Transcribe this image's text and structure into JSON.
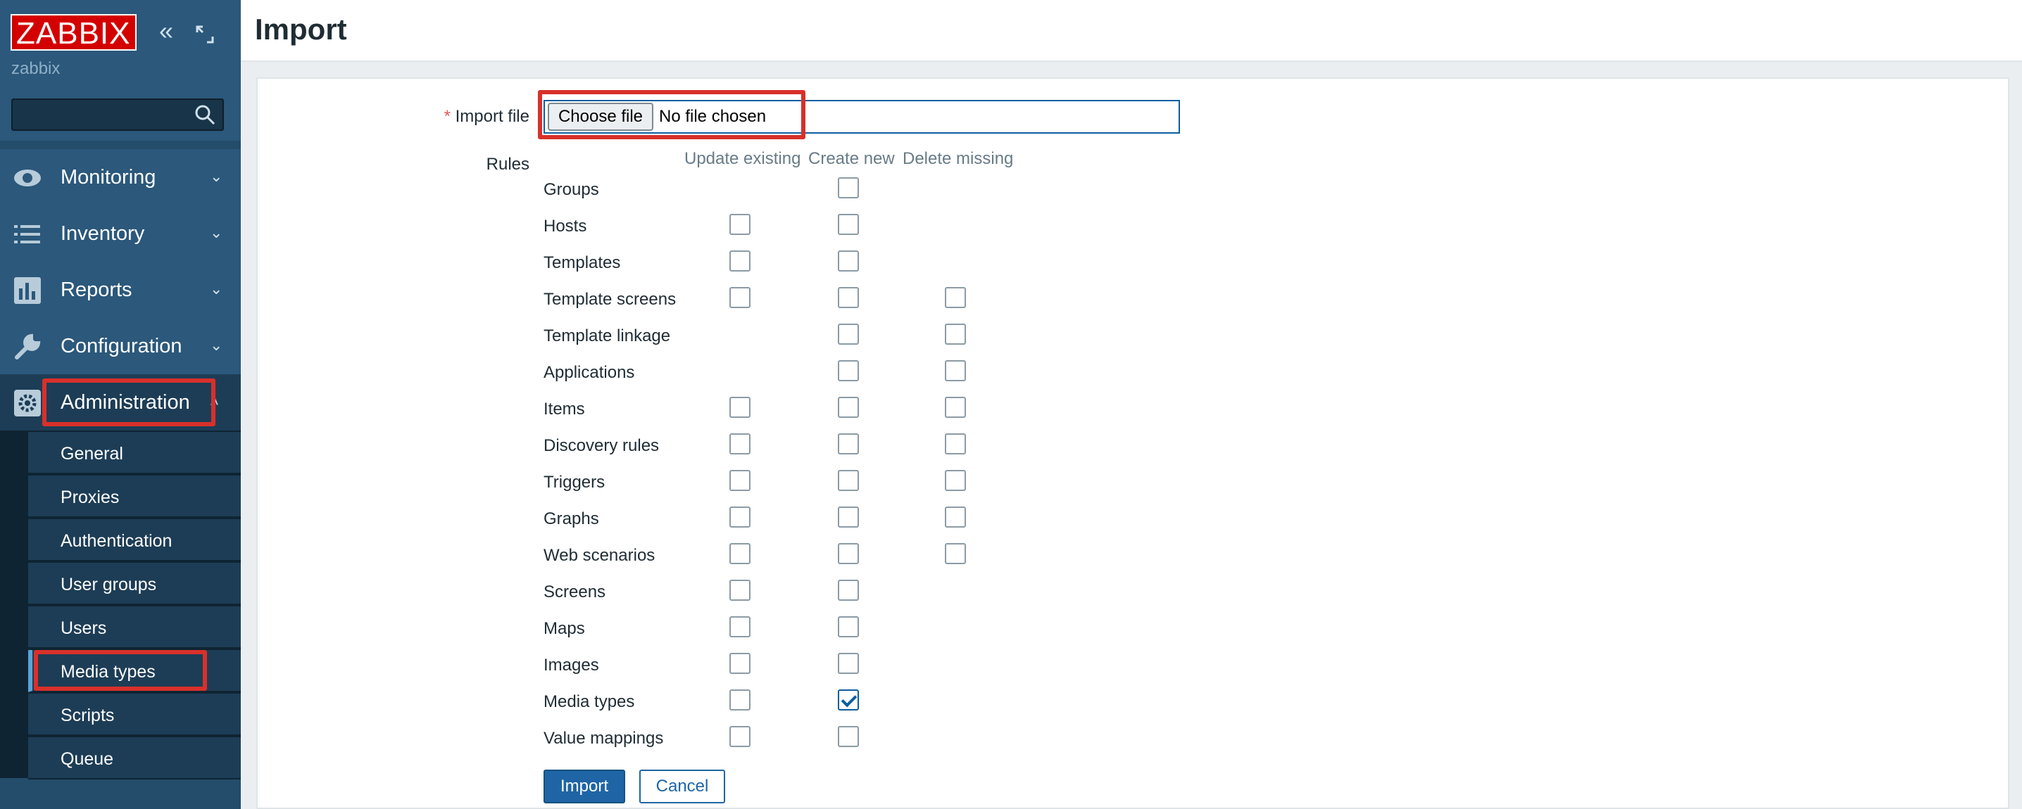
{
  "brand": {
    "logo_text": "ZABBIX",
    "server_name": "zabbix",
    "collapse_icon": "chevrons-left-icon",
    "kiosk_icon": "expand-icon"
  },
  "sidebar": {
    "menu": [
      {
        "label": "Monitoring",
        "icon": "eye-icon"
      },
      {
        "label": "Inventory",
        "icon": "list-icon"
      },
      {
        "label": "Reports",
        "icon": "bar-chart-icon"
      },
      {
        "label": "Configuration",
        "icon": "wrench-icon"
      },
      {
        "label": "Administration",
        "icon": "gear-icon"
      }
    ],
    "submenu": [
      "General",
      "Proxies",
      "Authentication",
      "User groups",
      "Users",
      "Media types",
      "Scripts",
      "Queue"
    ]
  },
  "page": {
    "title": "Import"
  },
  "form": {
    "import_file_label": "Import file",
    "required_mark": "*",
    "choose_file": "Choose file",
    "no_file": "No file chosen",
    "rules_label": "Rules",
    "columns": [
      "Update existing",
      "Create new",
      "Delete missing"
    ],
    "rules": [
      {
        "label": "Groups",
        "update": null,
        "create": false,
        "delete": null
      },
      {
        "label": "Hosts",
        "update": false,
        "create": false,
        "delete": null
      },
      {
        "label": "Templates",
        "update": false,
        "create": false,
        "delete": null
      },
      {
        "label": "Template screens",
        "update": false,
        "create": false,
        "delete": false
      },
      {
        "label": "Template linkage",
        "update": null,
        "create": false,
        "delete": false
      },
      {
        "label": "Applications",
        "update": null,
        "create": false,
        "delete": false
      },
      {
        "label": "Items",
        "update": false,
        "create": false,
        "delete": false
      },
      {
        "label": "Discovery rules",
        "update": false,
        "create": false,
        "delete": false
      },
      {
        "label": "Triggers",
        "update": false,
        "create": false,
        "delete": false
      },
      {
        "label": "Graphs",
        "update": false,
        "create": false,
        "delete": false
      },
      {
        "label": "Web scenarios",
        "update": false,
        "create": false,
        "delete": false
      },
      {
        "label": "Screens",
        "update": false,
        "create": false,
        "delete": null
      },
      {
        "label": "Maps",
        "update": false,
        "create": false,
        "delete": null
      },
      {
        "label": "Images",
        "update": false,
        "create": false,
        "delete": null
      },
      {
        "label": "Media types",
        "update": false,
        "create": true,
        "delete": null
      },
      {
        "label": "Value mappings",
        "update": false,
        "create": false,
        "delete": null
      }
    ],
    "import_button": "Import",
    "cancel_button": "Cancel"
  },
  "colors": {
    "sidebar": "#244c6b",
    "accent": "#1f65a5",
    "highlight": "#d9302a",
    "logo": "#d40000"
  }
}
